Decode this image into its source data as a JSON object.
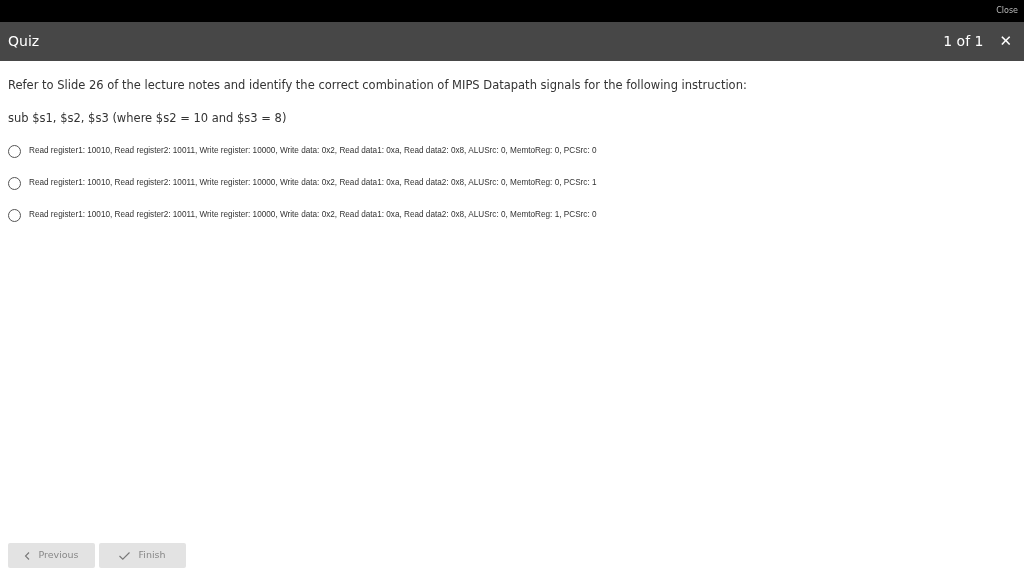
{
  "top_bar": {
    "close_label": "Close"
  },
  "header": {
    "title": "Quiz",
    "progress": "1 of 1",
    "close_glyph": "✕"
  },
  "question": {
    "prompt": "Refer to Slide 26 of the lecture notes and identify the correct combination of MIPS Datapath signals for the following instruction:",
    "instruction": "sub $s1, $s2, $s3 (where $s2 = 10 and $s3 = 8)"
  },
  "options": [
    {
      "label": "Read register1: 10010, Read register2: 10011, Write register: 10000, Write data: 0x2, Read data1: 0xa, Read data2: 0x8, ALUSrc: 0, MemtoReg: 0, PCSrc: 0",
      "selected": false
    },
    {
      "label": "Read register1: 10010, Read register2: 10011, Write register: 10000, Write data: 0x2, Read data1: 0xa, Read data2: 0x8, ALUSrc: 0, MemtoReg: 0, PCSrc: 1",
      "selected": false
    },
    {
      "label": "Read register1: 10010, Read register2: 10011, Write register: 10000, Write data: 0x2, Read data1: 0xa, Read data2: 0x8, ALUSrc: 0, MemtoReg: 1, PCSrc: 0",
      "selected": false
    }
  ],
  "buttons": [
    {
      "kind": "previous",
      "label": "Previous",
      "disabled": true
    },
    {
      "kind": "finish",
      "label": "Finish",
      "disabled": true
    }
  ]
}
